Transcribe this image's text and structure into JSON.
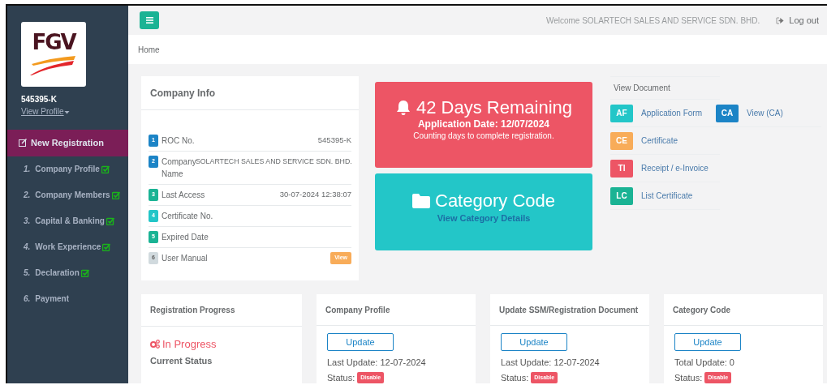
{
  "sidebar": {
    "logo_text": "FGV",
    "company_id": "545395-K",
    "view_profile": "View Profile",
    "section": {
      "label": "New Registration",
      "selected": true
    },
    "steps": [
      {
        "number": "1.",
        "label": "Company Profile",
        "completed": true
      },
      {
        "number": "2.",
        "label": "Company Members",
        "completed": true
      },
      {
        "number": "3.",
        "label": "Capital & Banking",
        "completed": true
      },
      {
        "number": "4.",
        "label": "Work Experience",
        "completed": true
      },
      {
        "number": "5.",
        "label": "Declaration",
        "completed": true
      },
      {
        "number": "6.",
        "label": "Payment",
        "completed": false
      }
    ]
  },
  "topbar": {
    "welcome": "Welcome SOLARTECH SALES AND SERVICE SDN. BHD.",
    "logout": "Log out"
  },
  "breadcrumb": "Home",
  "company_info": {
    "title": "Company Info",
    "rows": [
      {
        "number": "1",
        "color": "#1c84c6",
        "label": "ROC No.",
        "kind": "text",
        "value": "545395-K"
      },
      {
        "number": "2",
        "color": "#1c84c6",
        "label": "Company Name",
        "kind": "text",
        "value": "SOLARTECH SALES AND SERVICE SDN. BHD."
      },
      {
        "number": "3",
        "color": "#1ab394",
        "label": "Last Access",
        "kind": "text",
        "value": "30-07-2024 12:38:07"
      },
      {
        "number": "4",
        "color": "#23c6c8",
        "label": "Certificate No."
      },
      {
        "number": "5",
        "color": "#1ab394",
        "label": "Expired Date"
      },
      {
        "number": "6",
        "color": "#d1dade",
        "label": "User Manual",
        "kind": "link",
        "value": "View"
      }
    ]
  },
  "countdown": {
    "title": "42 Days Remaining",
    "subtitle": "Application Date: 12/07/2024",
    "note": "Counting days to complete registration."
  },
  "category": {
    "title": "Category Code",
    "link": "View Category Details"
  },
  "documents": {
    "title": "View Document",
    "rows": [
      [
        {
          "code": "AF",
          "label": "Application Form",
          "color": "#23c6c8"
        },
        {
          "code": "CA",
          "label": "View (CA)",
          "color": "#1c84c6"
        }
      ],
      [
        {
          "code": "CE",
          "label": "Certificate",
          "color": "#f8ac59"
        }
      ],
      [
        {
          "code": "TI",
          "label": "Receipt / e-Invoice",
          "color": "#ed5565"
        }
      ],
      [
        {
          "code": "LC",
          "label": "List Certificate",
          "color": "#1ab394"
        }
      ]
    ]
  },
  "progress": {
    "title": "Registration Progress",
    "status": "In Progress",
    "caption": "Current Status"
  },
  "update_cards": [
    {
      "title": "Company Profile",
      "button": "Update",
      "info": "Last Update: 12-07-2024",
      "status_label": "Status:",
      "status": "Disable"
    },
    {
      "title": "Update SSM/Registration Document",
      "button": "Update",
      "info": "Last Update: 12-07-2024",
      "status_label": "Status:",
      "status": "Disable"
    },
    {
      "title": "Category Code",
      "button": "Update",
      "info": "Total Update: 0",
      "status_label": "Status:",
      "status": "Disable"
    }
  ]
}
